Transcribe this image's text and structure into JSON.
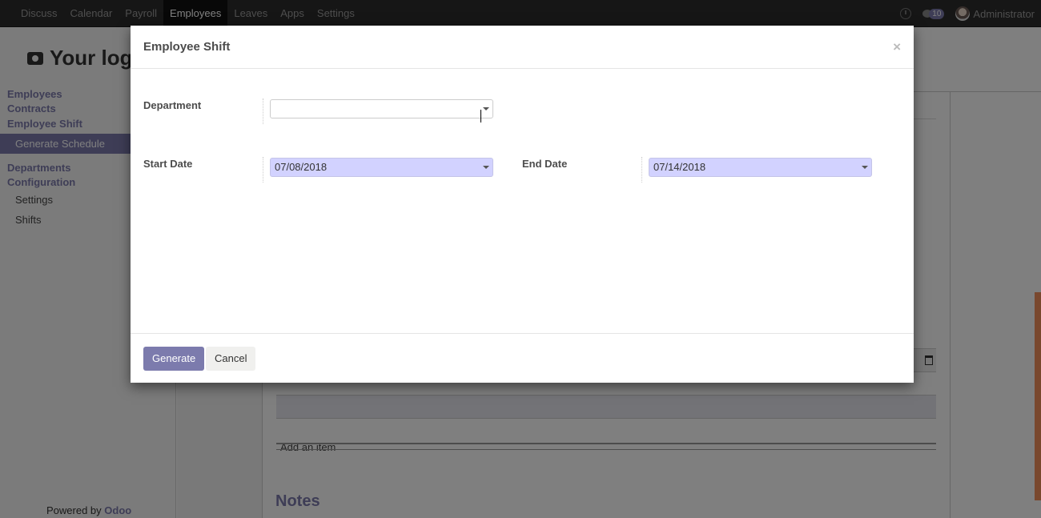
{
  "navbar": {
    "menu": [
      {
        "label": "Discuss",
        "active": false
      },
      {
        "label": "Calendar",
        "active": false
      },
      {
        "label": "Payroll",
        "active": false
      },
      {
        "label": "Employees",
        "active": true
      },
      {
        "label": "Leaves",
        "active": false
      },
      {
        "label": "Apps",
        "active": false
      },
      {
        "label": "Settings",
        "active": false
      }
    ],
    "activity_icon": "clock-icon",
    "messages_icon": "chat-icon",
    "message_count": "10",
    "user_name": "Administrator"
  },
  "sidebar": {
    "logo_text": "Your logo",
    "logo_icon": "camera-icon",
    "sections": [
      {
        "label": "Employees"
      },
      {
        "label": "Contracts"
      },
      {
        "label": "Employee Shift"
      }
    ],
    "employee_shift_items": [
      {
        "label": "Generate Schedule",
        "active": true
      }
    ],
    "departments_label": "Departments",
    "configuration_label": "Configuration",
    "configuration_items": [
      {
        "label": "Settings"
      },
      {
        "label": "Shifts"
      }
    ],
    "powered_by": "Powered by",
    "powered_brand": "Odoo"
  },
  "background_form": {
    "add_item_label": "Add an item",
    "notes_title": "Notes"
  },
  "dialog": {
    "title": "Employee Shift",
    "close_label": "×",
    "fields": {
      "department": {
        "label": "Department",
        "value": ""
      },
      "start_date": {
        "label": "Start Date",
        "value": "07/08/2018"
      },
      "end_date": {
        "label": "End Date",
        "value": "07/14/2018"
      }
    },
    "buttons": {
      "generate": "Generate",
      "cancel": "Cancel"
    }
  }
}
